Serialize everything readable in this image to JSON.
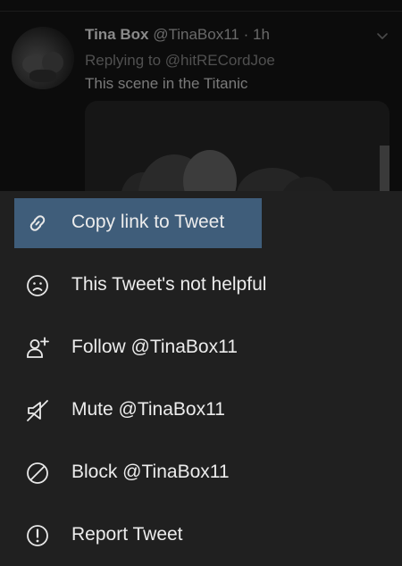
{
  "tweet": {
    "name": "Tina Box",
    "handle": "@TinaBox11",
    "separator": "·",
    "time": "1h",
    "replying_to": "Replying to @hitRECordJoe",
    "text": "This scene in the Titanic"
  },
  "menu": {
    "selected_color": "#3f5d7a",
    "items": [
      {
        "label": "Copy link to Tweet",
        "icon": "link-icon",
        "selected": true
      },
      {
        "label": "This Tweet's not helpful",
        "icon": "sad-face-icon",
        "selected": false
      },
      {
        "label": "Follow @TinaBox11",
        "icon": "follow-user-icon",
        "selected": false
      },
      {
        "label": "Mute @TinaBox11",
        "icon": "mute-icon",
        "selected": false
      },
      {
        "label": "Block @TinaBox11",
        "icon": "block-icon",
        "selected": false
      },
      {
        "label": "Report Tweet",
        "icon": "report-icon",
        "selected": false
      }
    ]
  }
}
